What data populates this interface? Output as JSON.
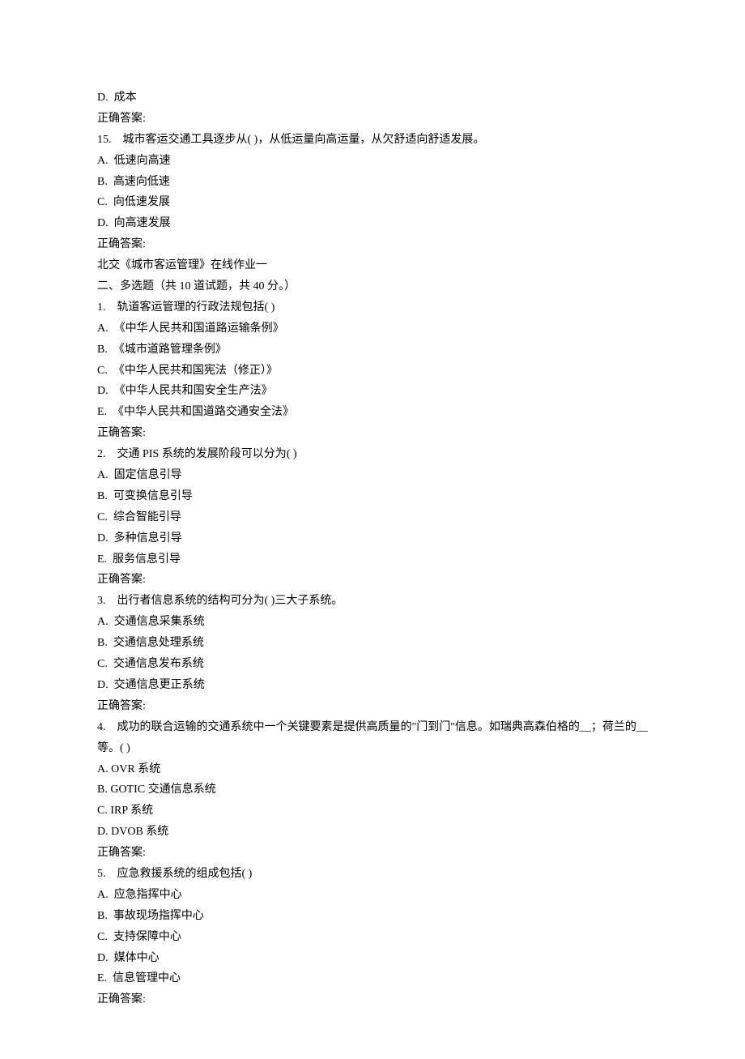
{
  "lines": [
    "D.  成本",
    "正确答案:",
    "15.    城市客运交通工具逐步从( )，从低运量向高运量，从欠舒适向舒适发展。",
    "A.  低速向高速",
    "B.  高速向低速",
    "C.  向低速发展",
    "D.  向高速发展",
    "正确答案:",
    "北交《城市客运管理》在线作业一",
    "二、多选题（共 10 道试题，共 40 分。）",
    "1.    轨道客运管理的行政法规包括( )",
    "A.  《中华人民共和国道路运输条例》",
    "B.  《城市道路管理条例》",
    "C.  《中华人民共和国宪法（修正）》",
    "D.  《中华人民共和国安全生产法》",
    "E.  《中华人民共和国道路交通安全法》",
    "正确答案:",
    "2.    交通 PIS 系统的发展阶段可以分为( )",
    "A.  固定信息引导",
    "B.  可变换信息引导",
    "C.  综合智能引导",
    "D.  多种信息引导",
    "E.  服务信息引导",
    "正确答案:",
    "3.    出行者信息系统的结构可分为( )三大子系统。",
    "A.  交通信息采集系统",
    "B.  交通信息处理系统",
    "C.  交通信息发布系统",
    "D.  交通信息更正系统",
    "正确答案:",
    "4.    成功的联合运输的交通系统中一个关键要素是提供高质量的\"门到门\"信息。如瑞典高森伯格的__；荷兰的__等。( )",
    "A. OVR 系统",
    "B. GOTIC 交通信息系统",
    "C. IRP 系统",
    "D. DVOB 系统",
    "正确答案:",
    "5.    应急救援系统的组成包括( )",
    "A.  应急指挥中心",
    "B.  事故现场指挥中心",
    "C.  支持保障中心",
    "D.  媒体中心",
    "E.  信息管理中心",
    "正确答案:"
  ]
}
